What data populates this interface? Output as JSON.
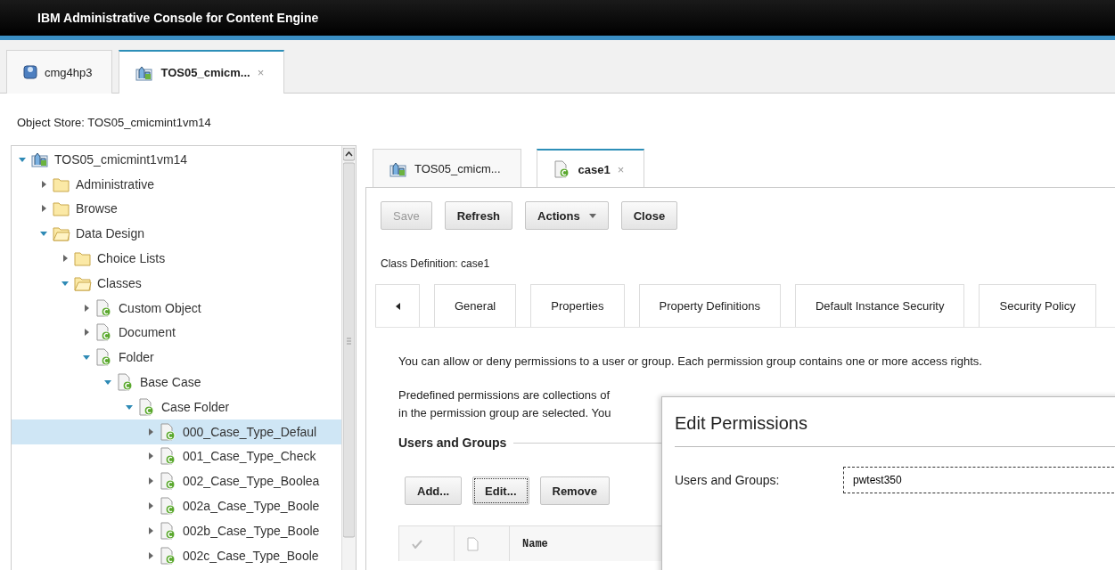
{
  "header": {
    "title": "IBM Administrative Console for Content Engine"
  },
  "top_tabs": [
    {
      "label": "cmg4hp3",
      "kind": "database",
      "selected": false
    },
    {
      "label": "TOS05_cmicm...",
      "kind": "store",
      "selected": true,
      "close": "×"
    }
  ],
  "object_store_label": "Object Store: TOS05_cmicmint1vm14",
  "tree": [
    {
      "label": "TOS05_cmicmint1vm14",
      "kind": "store",
      "expanded": true,
      "selected": false,
      "children": [
        {
          "label": "Administrative",
          "kind": "folder",
          "expanded": false,
          "selected": false
        },
        {
          "label": "Browse",
          "kind": "folder",
          "expanded": false,
          "selected": false
        },
        {
          "label": "Data Design",
          "kind": "folder",
          "expanded": true,
          "selected": false,
          "children": [
            {
              "label": "Choice Lists",
              "kind": "folder",
              "expanded": false,
              "selected": false
            },
            {
              "label": "Classes",
              "kind": "folder",
              "expanded": true,
              "selected": false,
              "children": [
                {
                  "label": "Custom Object",
                  "kind": "class",
                  "expanded": false,
                  "selected": false
                },
                {
                  "label": "Document",
                  "kind": "class",
                  "expanded": false,
                  "selected": false
                },
                {
                  "label": "Folder",
                  "kind": "class",
                  "expanded": true,
                  "selected": false,
                  "children": [
                    {
                      "label": "Base Case",
                      "kind": "class",
                      "expanded": true,
                      "selected": false,
                      "children": [
                        {
                          "label": "Case Folder",
                          "kind": "class",
                          "expanded": true,
                          "selected": false,
                          "children": [
                            {
                              "label": "000_Case_Type_Defaul",
                              "kind": "class",
                              "expanded": false,
                              "selected": true
                            },
                            {
                              "label": "001_Case_Type_Check",
                              "kind": "class",
                              "expanded": false,
                              "selected": false
                            },
                            {
                              "label": "002_Case_Type_Boolea",
                              "kind": "class",
                              "expanded": false,
                              "selected": false
                            },
                            {
                              "label": "002a_Case_Type_Boole",
                              "kind": "class",
                              "expanded": false,
                              "selected": false
                            },
                            {
                              "label": "002b_Case_Type_Boole",
                              "kind": "class",
                              "expanded": false,
                              "selected": false
                            },
                            {
                              "label": "002c_Case_Type_Boole",
                              "kind": "class",
                              "expanded": false,
                              "selected": false
                            }
                          ]
                        }
                      ]
                    }
                  ]
                }
              ]
            }
          ]
        }
      ]
    }
  ],
  "detail_tabs": [
    {
      "label": "TOS05_cmicm...",
      "kind": "store",
      "selected": false
    },
    {
      "label": "case1",
      "kind": "class",
      "selected": true,
      "close": "×"
    }
  ],
  "toolbar": [
    {
      "label": "Save",
      "kind": "button",
      "disabled": true
    },
    {
      "label": "Refresh",
      "kind": "button",
      "disabled": false
    },
    {
      "label": "Actions",
      "kind": "menu",
      "disabled": false
    },
    {
      "label": "Close",
      "kind": "button",
      "disabled": false
    }
  ],
  "class_definition": "Class Definition: case1",
  "section_tabs": [
    "General",
    "Properties",
    "Property Definitions",
    "Default Instance Security",
    "Security Policy"
  ],
  "intro": "You can allow or deny permissions to a user or group. Each permission group contains one or more access rights.",
  "predefined_lines": [
    "Predefined permissions are collections of",
    "in the permission group are selected. You"
  ],
  "users_groups": {
    "title": "Users and Groups",
    "buttons": [
      {
        "label": "Add...",
        "focused": false
      },
      {
        "label": "Edit...",
        "focused": true
      },
      {
        "label": "Remove",
        "focused": false
      }
    ],
    "columns": [
      {
        "kind": "check"
      },
      {
        "kind": "document"
      },
      {
        "kind": "text",
        "label": "Name"
      }
    ]
  },
  "dialog": {
    "title": "Edit Permissions",
    "field_label": "Users and Groups:",
    "field_value": "pwtest350"
  }
}
